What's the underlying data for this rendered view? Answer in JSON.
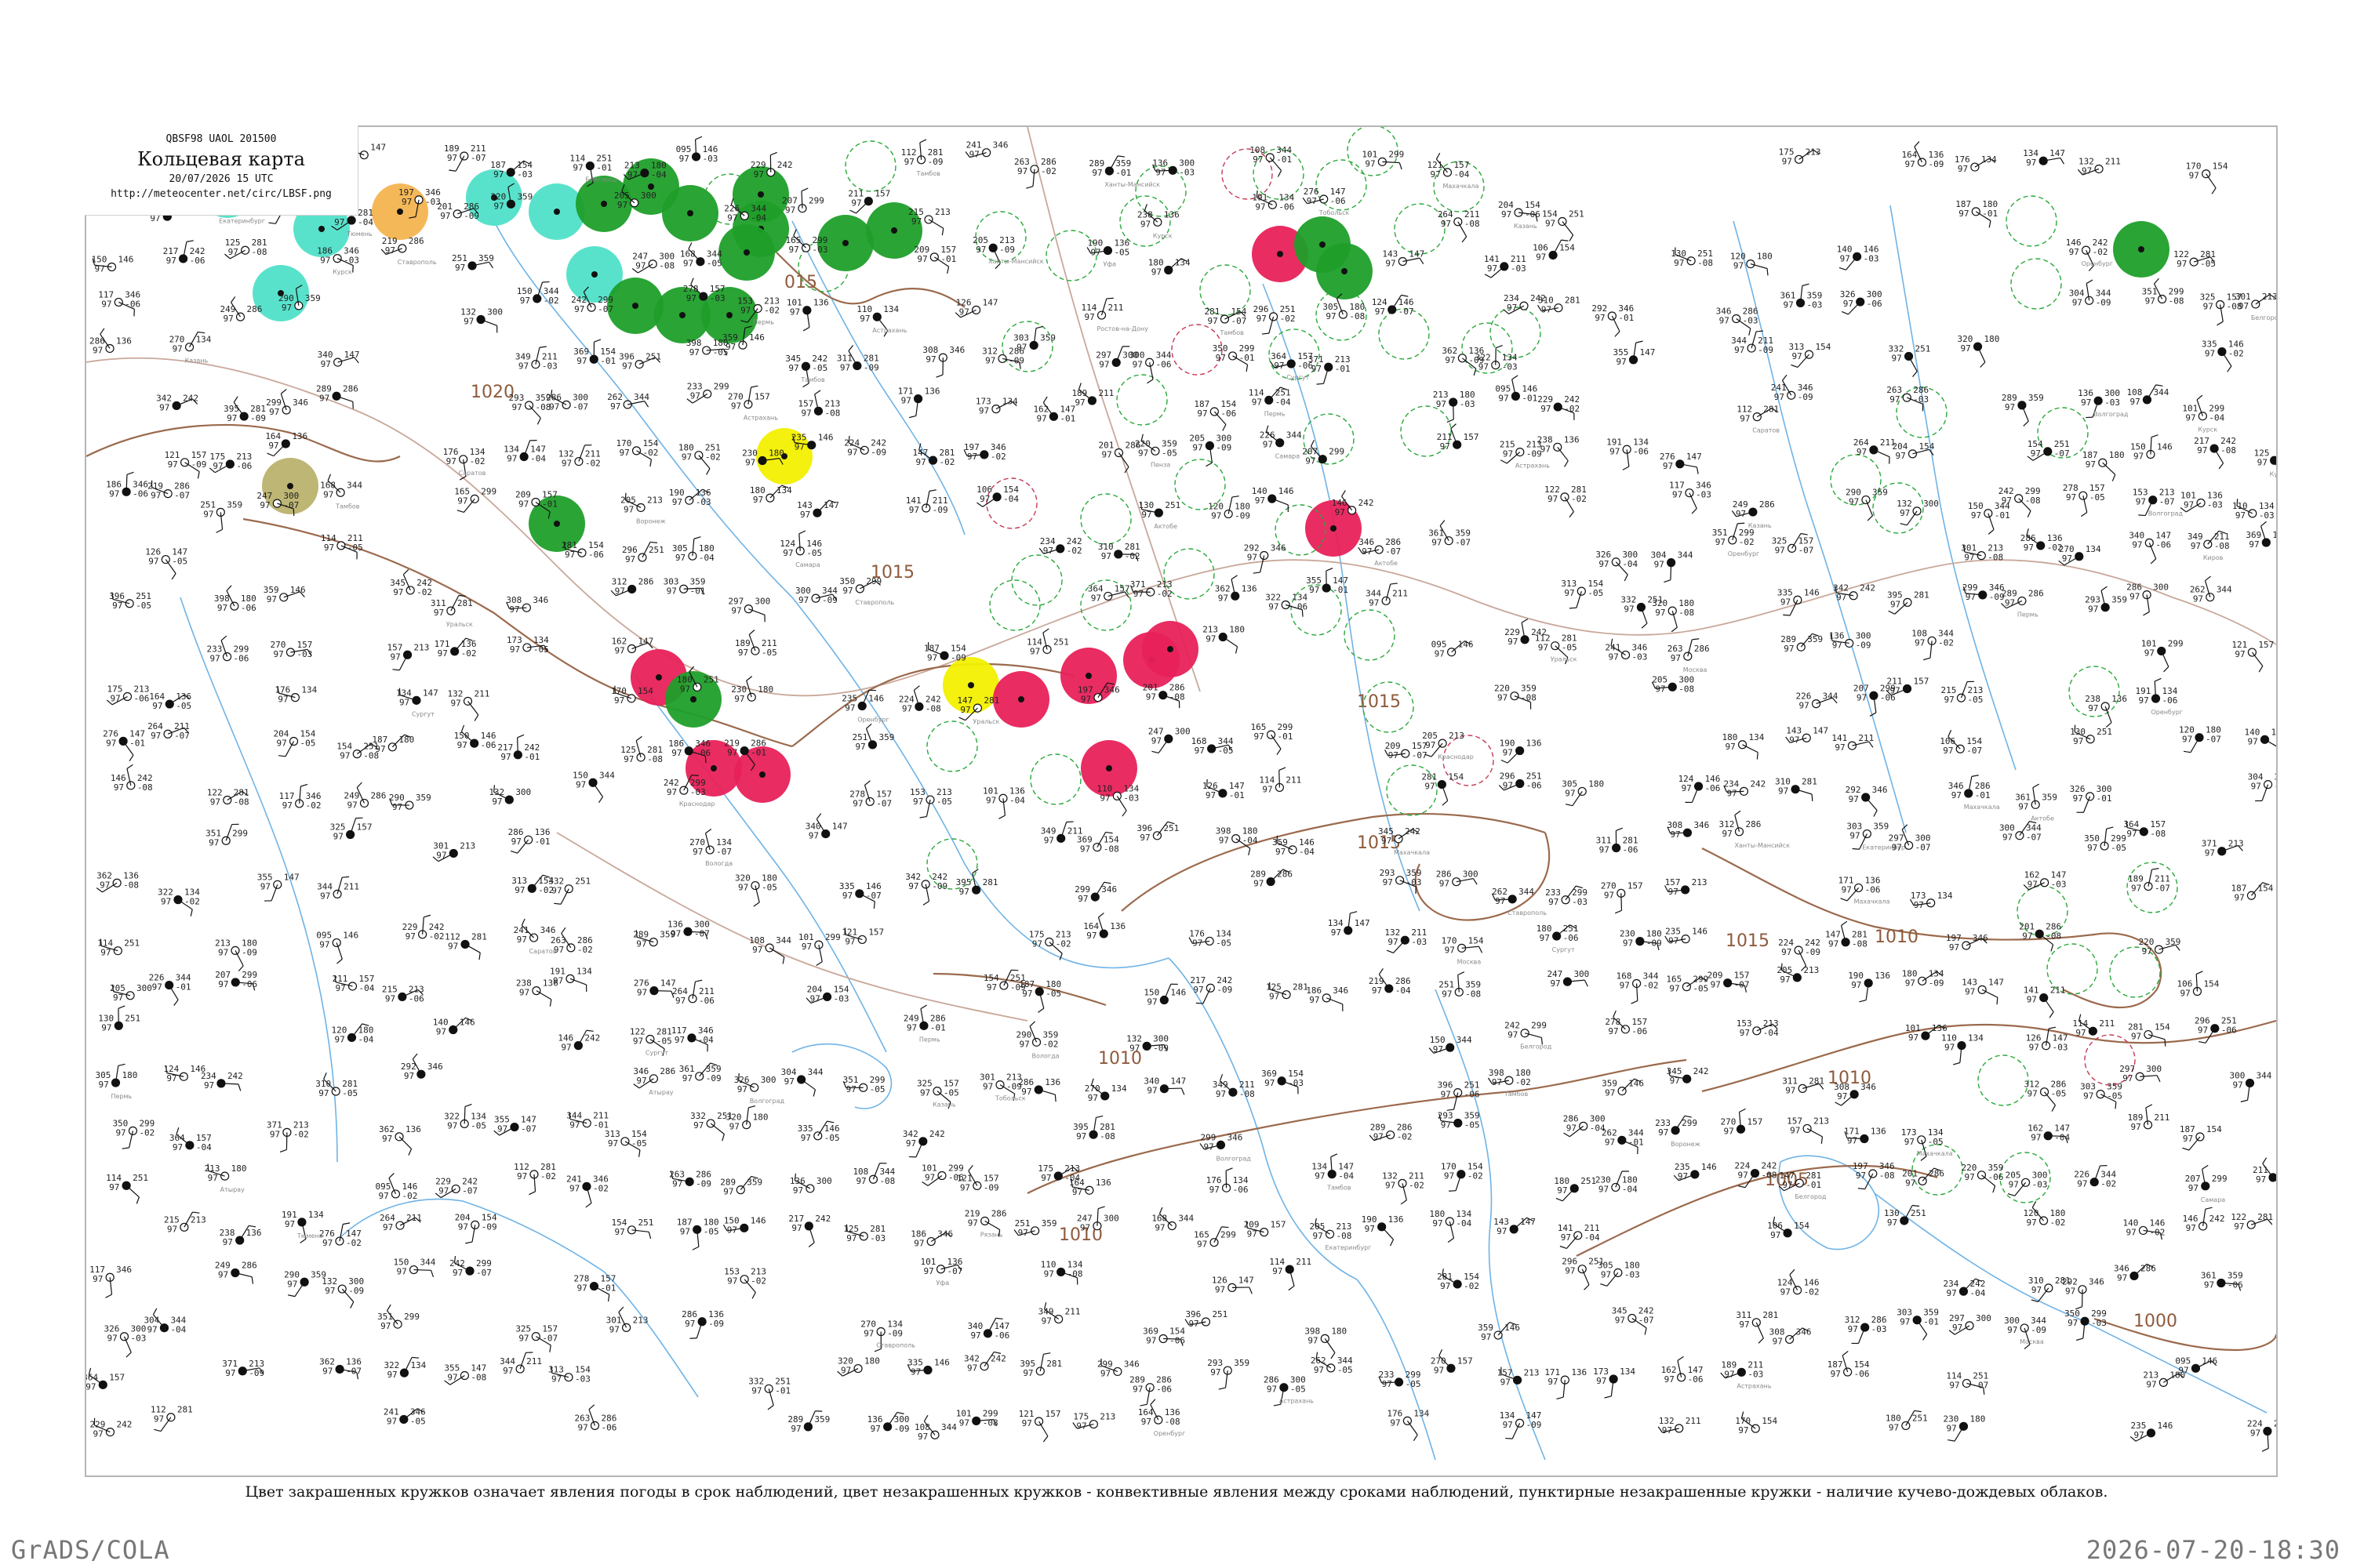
{
  "header": {
    "code": "QBSF98  UAOL  201500",
    "title": "Кольцевая карта",
    "datetime": "20/07/2026 15 UTC",
    "url": "http://meteocenter.net/circ/LBSF.png"
  },
  "caption": "Цвет закрашенных кружков означает явления погоды в срок наблюдений, цвет незакрашенных кружков - конвективные явления между сроками наблюдений, пунктирные незакрашенные кружки - наличие кучево-дождевых облаков.",
  "footer": {
    "left": "GrADS/COLA",
    "right": "2026-07-20-18:30"
  },
  "colors": {
    "coast": "#6fb3e6",
    "border": "#c9a89a",
    "isobar": "#9b6a4d",
    "rain": "#1f9f2a",
    "drizzle": "#50e0c8",
    "thunder": "#e8215a",
    "fog": "#f2f000",
    "haze": "#f4b450",
    "dust": "#b9b26e",
    "cb_circle": "#2aa83a",
    "tstorm_circle": "#c43a55"
  },
  "isobar_labels": [
    "1020",
    "015",
    "1015",
    "1015",
    "1015",
    "1015",
    "1010",
    "1010",
    "1010",
    "1010",
    "1005",
    "1000"
  ],
  "station_pressures": [
    "157",
    "171",
    "173",
    "162",
    "189",
    "187",
    "114",
    "213",
    "095",
    "229",
    "112",
    "241",
    "263",
    "289",
    "136",
    "108",
    "101",
    "121",
    "175",
    "164",
    "176",
    "134",
    "132",
    "170",
    "180",
    "230",
    "235",
    "224",
    "147",
    "197",
    "201",
    "220",
    "205",
    "226",
    "207",
    "211",
    "215",
    "238",
    "191",
    "276",
    "264",
    "204",
    "154",
    "187",
    "150",
    "217",
    "125",
    "186",
    "219",
    "251",
    "247",
    "168",
    "165",
    "209",
    "205",
    "190",
    "180",
    "143",
    "141",
    "106",
    "130",
    "120",
    "140",
    "146",
    "122",
    "117",
    "249",
    "290",
    "132",
    "150",
    "242",
    "278",
    "153",
    "101",
    "110",
    "126",
    "114",
    "281",
    "296",
    "305",
    "124",
    "234",
    "310",
    "292",
    "346",
    "361",
    "326",
    "304",
    "351",
    "325",
    "301",
    "286",
    "270",
    "340",
    "349",
    "369",
    "396",
    "398",
    "359",
    "345",
    "311",
    "308",
    "312",
    "303",
    "297",
    "300",
    "350",
    "364",
    "371",
    "362",
    "322",
    "355",
    "344",
    "313",
    "332",
    "320",
    "335",
    "342",
    "395",
    "299",
    "289",
    "293",
    "286",
    "262",
    "233",
    "270"
  ],
  "station_names": [
    "Ханты-Мансийск",
    "Сургут",
    "Тобольск",
    "Тюмень",
    "Екатеринбург",
    "Пермь",
    "Киров",
    "Вологда",
    "Москва",
    "Рязань",
    "Тамбов",
    "Воронеж",
    "Белгород",
    "Курск",
    "Саратов",
    "Самара",
    "Уфа",
    "Оренбург",
    "Казань",
    "Пенза",
    "Волгоград",
    "Ростов-на-Дону",
    "Краснодар",
    "Ставрополь",
    "Астрахань",
    "Элиста",
    "Махачкала",
    "Актобе",
    "Уральск",
    "Атырау"
  ]
}
